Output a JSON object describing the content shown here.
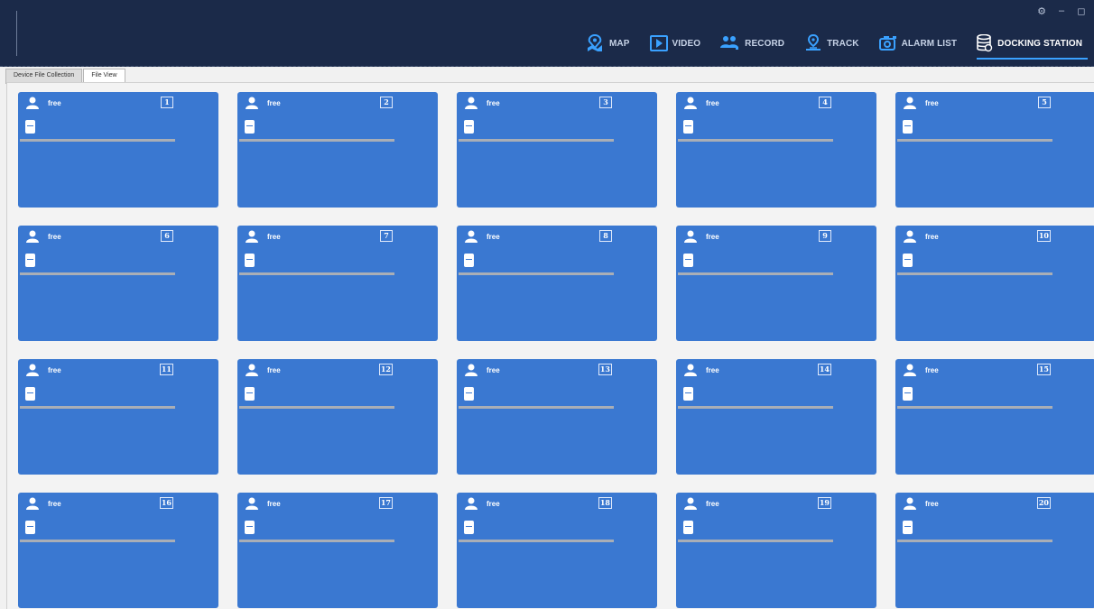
{
  "nav": {
    "items": [
      {
        "label": "MAP",
        "icon": "map-pin-icon",
        "active": false
      },
      {
        "label": "VIDEO",
        "icon": "play-icon",
        "active": false
      },
      {
        "label": "RECORD",
        "icon": "people-icon",
        "active": false
      },
      {
        "label": "TRACK",
        "icon": "track-pin-icon",
        "active": false
      },
      {
        "label": "ALARM LIST",
        "icon": "camera-icon",
        "active": false
      },
      {
        "label": "DOCKING STATION",
        "icon": "database-icon",
        "active": true
      }
    ]
  },
  "window_controls": {
    "settings": "⚙",
    "minimize": "–",
    "maximize": "◻"
  },
  "tabs": [
    {
      "label": "Device File Collection",
      "active": false
    },
    {
      "label": "File View",
      "active": true
    }
  ],
  "colors": {
    "card": "#3a78d1",
    "header": "#1b2a49",
    "accent": "#3aa1ff"
  },
  "cards": [
    {
      "status": "free",
      "number": "1"
    },
    {
      "status": "free",
      "number": "2"
    },
    {
      "status": "free",
      "number": "3"
    },
    {
      "status": "free",
      "number": "4"
    },
    {
      "status": "free",
      "number": "5"
    },
    {
      "status": "free",
      "number": "6"
    },
    {
      "status": "free",
      "number": "7"
    },
    {
      "status": "free",
      "number": "8"
    },
    {
      "status": "free",
      "number": "9"
    },
    {
      "status": "free",
      "number": "10"
    },
    {
      "status": "free",
      "number": "11"
    },
    {
      "status": "free",
      "number": "12"
    },
    {
      "status": "free",
      "number": "13"
    },
    {
      "status": "free",
      "number": "14"
    },
    {
      "status": "free",
      "number": "15"
    },
    {
      "status": "free",
      "number": "16"
    },
    {
      "status": "free",
      "number": "17"
    },
    {
      "status": "free",
      "number": "18"
    },
    {
      "status": "free",
      "number": "19"
    },
    {
      "status": "free",
      "number": "20"
    }
  ]
}
